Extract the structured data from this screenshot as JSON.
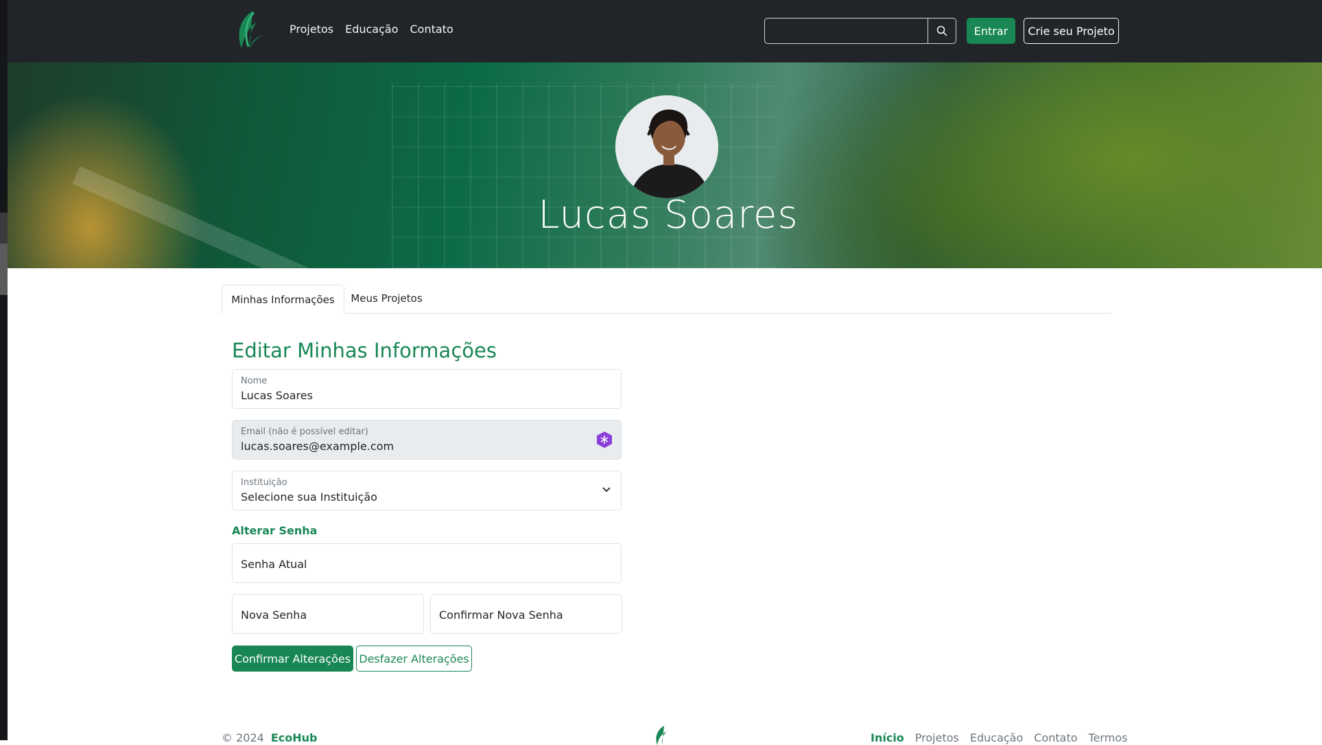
{
  "nav": {
    "links": [
      "Projetos",
      "Educação",
      "Contato"
    ],
    "search_placeholder": "",
    "login_label": "Entrar",
    "create_label": "Crie seu Projeto"
  },
  "profile": {
    "name": "Lucas Soares"
  },
  "tabs": [
    "Minhas Informações",
    "Meus Projetos"
  ],
  "form": {
    "title": "Editar Minhas Informações",
    "name_label": "Nome",
    "name_value": "Lucas Soares",
    "email_label": "Email (não é possível editar)",
    "email_value": "lucas.soares@example.com",
    "institution_label": "Instituição",
    "institution_value": "Selecione sua Instituição",
    "password_section": "Alterar Senha",
    "current_password_placeholder": "Senha Atual",
    "new_password_placeholder": "Nova Senha",
    "confirm_password_placeholder": "Confirmar Nova Senha",
    "confirm_button": "Confirmar Alterações",
    "undo_button": "Desfazer Alterações"
  },
  "footer": {
    "copyright": "© 2024",
    "brand": "EcoHub",
    "links": [
      "Início",
      "Projetos",
      "Educação",
      "Contato",
      "Termos"
    ]
  },
  "colors": {
    "brand_green": "#198754",
    "navbar_bg": "#212529"
  }
}
